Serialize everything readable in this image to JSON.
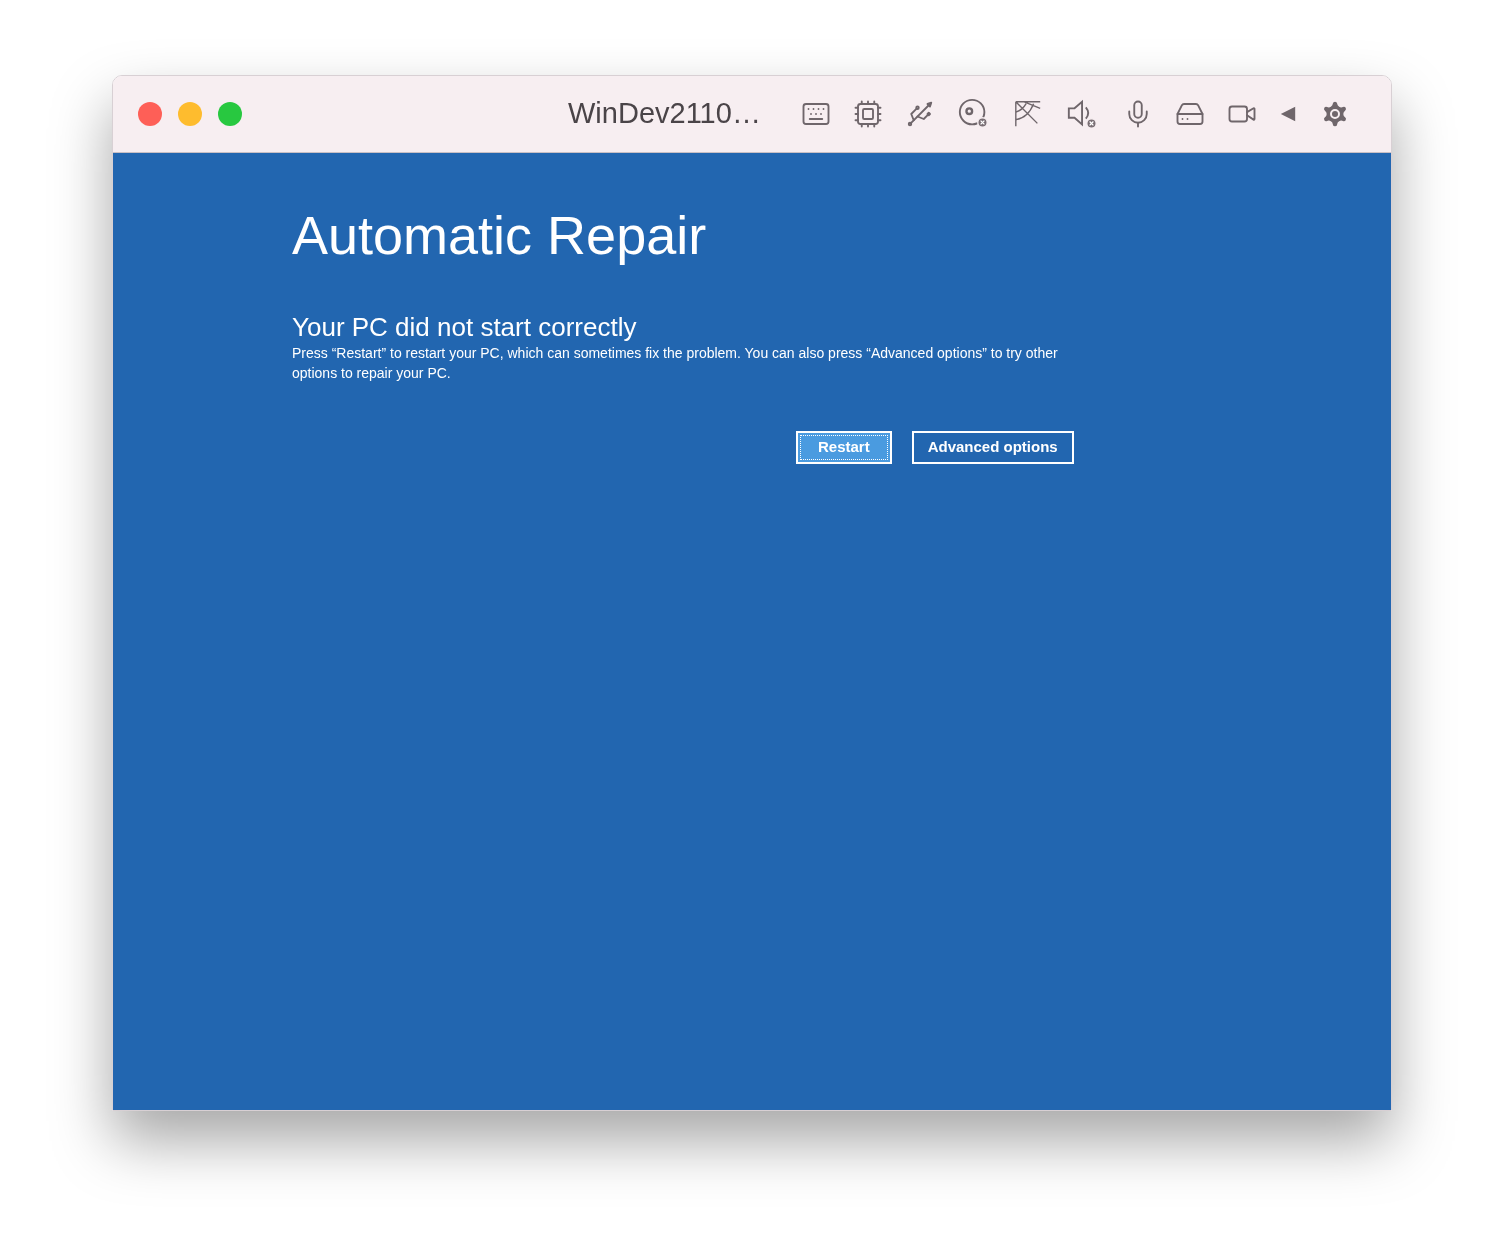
{
  "window": {
    "title": "WinDev2110…"
  },
  "screen": {
    "heading": "Automatic Repair",
    "subheading": "Your PC did not start correctly",
    "message": "Press “Restart” to restart your PC, which can sometimes fix the problem. You can also press “Advanced options” to try other options to repair your PC.",
    "buttons": [
      {
        "label": "Restart",
        "focused": true
      },
      {
        "label": "Advanced options",
        "focused": false
      }
    ]
  }
}
